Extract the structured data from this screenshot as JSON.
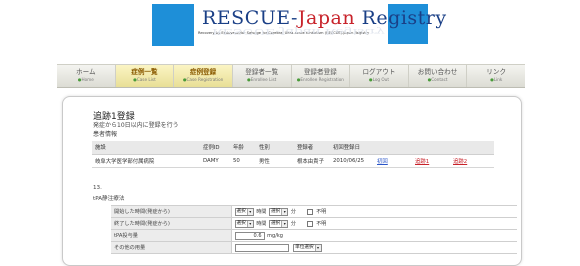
{
  "header": {
    "logo_title_main": "RESCUE-",
    "logo_title_japan": "Japan",
    "logo_title_registry": " Registry",
    "logo_subtitle": "Recovery by Endovascular Salvage for Cerebral Ultra-acute Embolism (RESCUE)-Japan Registry",
    "logo_reflection": "RESCUE-Japan Registry",
    "brand_color": "#1e8fd8"
  },
  "nav": [
    {
      "label": "ホーム",
      "en": "Home"
    },
    {
      "label": "症例一覧",
      "en": "Case List"
    },
    {
      "label": "症例登録",
      "en": "Case Registration"
    },
    {
      "label": "登録者一覧",
      "en": "Enrollee List"
    },
    {
      "label": "登録者登録",
      "en": "Enrollee Registration"
    },
    {
      "label": "ログアウト",
      "en": "Log Out"
    },
    {
      "label": "お問い合わせ",
      "en": "Contact"
    },
    {
      "label": "リンク",
      "en": "Link"
    }
  ],
  "page": {
    "title": "追跡1登録",
    "subtitle": "発症から10日以内に登録を行う",
    "patient_section": "患者情報"
  },
  "patient_table": {
    "headers": [
      "施設",
      "症例ID",
      "年齢",
      "性別",
      "登録者",
      "初回登録日",
      "",
      "",
      ""
    ],
    "row": [
      "岐阜大学医学部付属病院",
      "DAMY",
      "50",
      "男性",
      "根本由貴子",
      "2010/06/25",
      "初回",
      "追跡1",
      "追跡2"
    ]
  },
  "section": {
    "number": "13.",
    "name": "tPA静注療法"
  },
  "form": {
    "start_label": "開始した時間(発症から)",
    "end_label": "終了した時間(発症から)",
    "dose_label": "tPA投与量",
    "other_label": "その他の用量",
    "select_placeholder": "選択",
    "hour_unit": "時間",
    "minute_unit": "分",
    "unknown_label": "不明",
    "dose_value": "0.6",
    "dose_unit": "mg/kg",
    "unit_select": "単位選択"
  }
}
